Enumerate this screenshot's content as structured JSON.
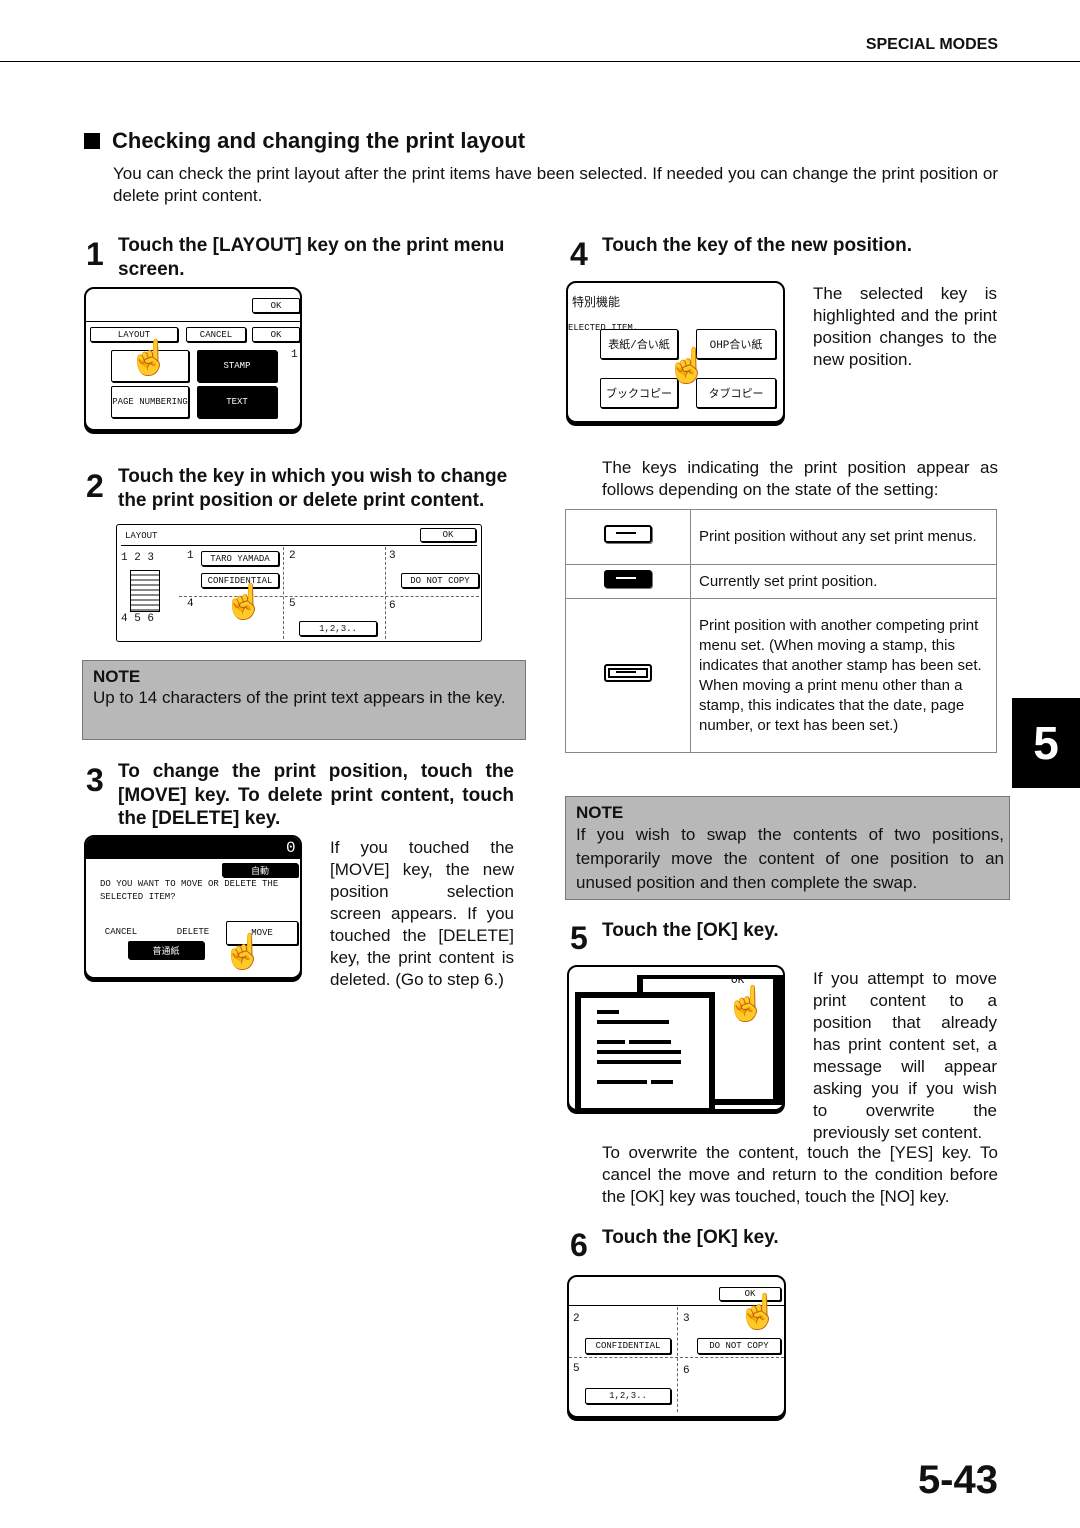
{
  "header": {
    "section": "SPECIAL MODES"
  },
  "section": {
    "title": "Checking and changing the print layout",
    "intro": "You can check the print layout after the print items have been selected. If needed you can change the print position or delete print content."
  },
  "steps": [
    {
      "num": "1",
      "heading": "Touch the [LAYOUT] key on the print menu screen."
    },
    {
      "num": "2",
      "heading": "Touch the key in which you wish to change the print position or delete print content."
    },
    {
      "num": "3",
      "heading": "To change the print position, touch the [MOVE] key. To delete print content, touch the [DELETE] key.",
      "body": "If you touched the [MOVE] key, the new position selection screen appears. If you touched the [DELETE] key, the print content is deleted. (Go to step 6.)"
    },
    {
      "num": "4",
      "heading": "Touch the key of the new position.",
      "body": "The selected key is highlighted and the print position changes to the new position.",
      "para": "The keys indicating the print position appear as follows depending on the state of the setting:"
    },
    {
      "num": "5",
      "heading": "Touch the [OK] key.",
      "body": "If you attempt to move print content to a position that already has print content set, a message will appear asking you if you wish to overwrite the previously set content.",
      "para": "To overwrite the content, touch the [YES] key. To cancel the move and return to the condition before the [OK] key was touched, touch the [NO] key."
    },
    {
      "num": "6",
      "heading": "Touch the [OK] key."
    }
  ],
  "notes": [
    {
      "title": "NOTE",
      "text": "Up to 14 characters of the print text appears in the key."
    },
    {
      "title": "NOTE",
      "text": "If you wish to swap the contents of two positions, temporarily move the content of one position to an unused position and then complete the swap."
    }
  ],
  "position_table": [
    {
      "icon": "key-normal",
      "text": "Print position without any set print menus."
    },
    {
      "icon": "key-highlighted",
      "text": "Currently set print position."
    },
    {
      "icon": "key-competing",
      "text": "Print position with another competing print menu set. (When moving a stamp, this indicates that another stamp has been set. When moving a print menu other than a stamp, this indicates that the date, page number, or text has been set.)"
    }
  ],
  "screen1": {
    "ok_top": "OK",
    "layout": "LAYOUT",
    "cancel": "CANCEL",
    "ok": "OK",
    "stamp": "STAMP",
    "page_numbering": "PAGE NUMBERING",
    "text": "TEXT",
    "fragment": "1."
  },
  "screen2": {
    "title": "LAYOUT",
    "ok": "OK",
    "diagram_top": "1  2  3",
    "diagram_bottom": "4  5  6",
    "cells": [
      "1",
      "2",
      "3",
      "4",
      "5",
      "6"
    ],
    "taro": "TARO YAMADA",
    "confidential": "CONFIDENTIAL",
    "donotcopy": "DO NOT COPY",
    "pagenum": "1,2,3.."
  },
  "screen3": {
    "counter": "0",
    "auto": "自動",
    "question1": "DO YOU WANT TO MOVE OR DELETE THE",
    "question2": "SELECTED ITEM?",
    "cancel": "CANCEL",
    "delete": "DELETE",
    "move": "MOVE",
    "plain": "普通紙"
  },
  "screen4": {
    "title": "特別機能",
    "selected": "ELECTED ITEM.",
    "k1": "表紙/合い紙",
    "k2": "OHP合い紙",
    "k3": "ブックコピー",
    "k4": "タブコピー"
  },
  "screen5": {
    "ok": "OK"
  },
  "screen6": {
    "ok": "OK",
    "c2": "2",
    "c3": "3",
    "c5": "5",
    "c6": "6",
    "confidential": "CONFIDENTIAL",
    "donotcopy": "DO NOT COPY",
    "pagenum": "1,2,3.."
  },
  "chapter_tab": "5",
  "page_number": "5-43"
}
